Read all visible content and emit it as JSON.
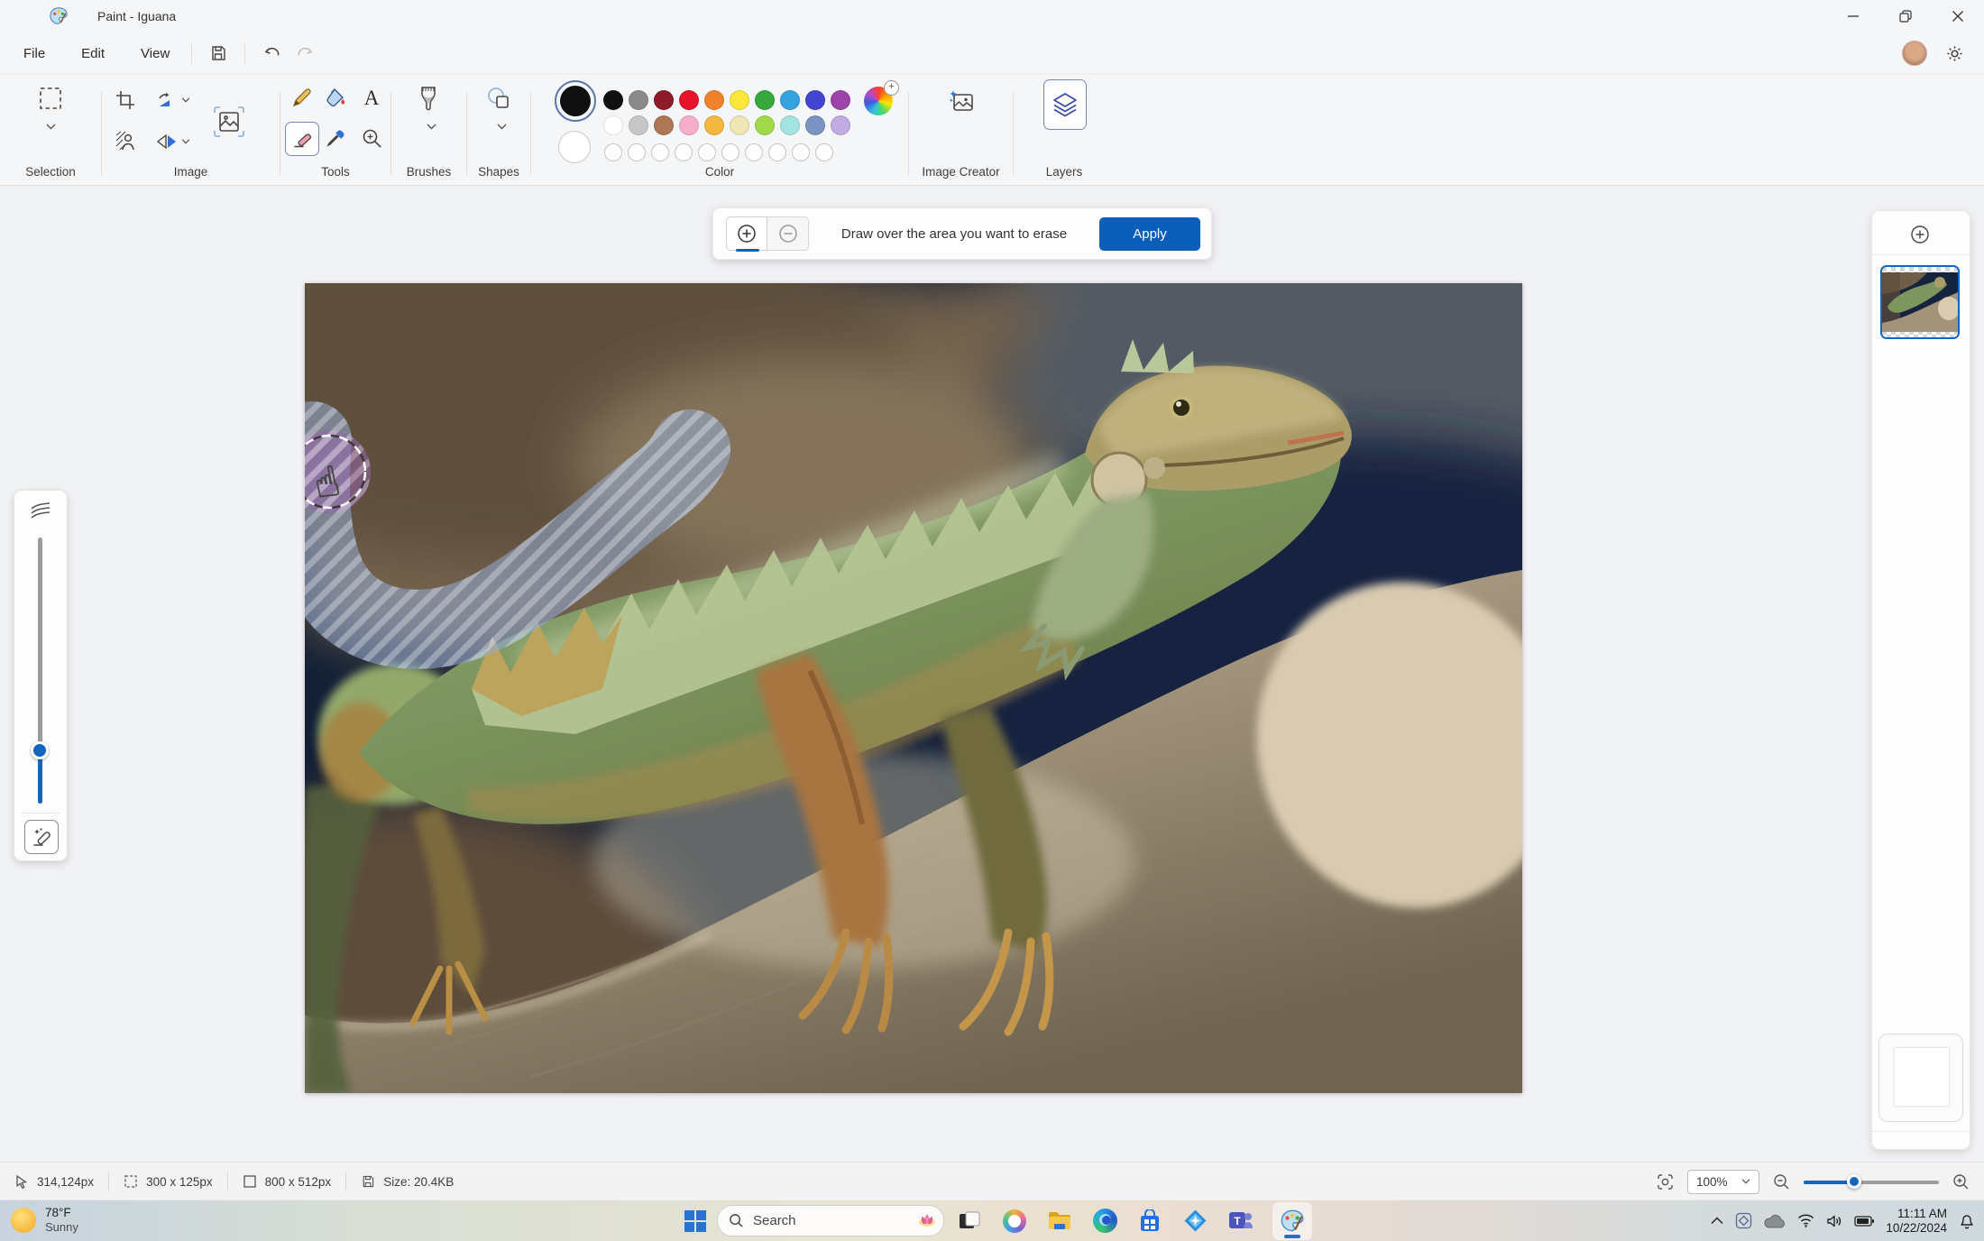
{
  "titlebar": {
    "title": "Paint - Iguana"
  },
  "menubar": {
    "items": [
      "File",
      "Edit",
      "View"
    ]
  },
  "ribbon": {
    "selection_label": "Selection",
    "image_label": "Image",
    "tools_label": "Tools",
    "brushes_label": "Brushes",
    "shapes_label": "Shapes",
    "color_label": "Color",
    "image_creator_label": "Image Creator",
    "layers_label": "Layers",
    "text_tool_glyph": "A",
    "primary_color": "#101010",
    "secondary_color": "#ffffff",
    "palette_row1": [
      "#101010",
      "#8a8a8a",
      "#8e1b2a",
      "#e7132c",
      "#f1822c",
      "#fbe83a",
      "#37a93c",
      "#35a3dd",
      "#4345d2",
      "#9c44a8"
    ],
    "palette_row2": [
      "#ffffff",
      "#c7c7c7",
      "#ad7756",
      "#f6aecb",
      "#f4b73f",
      "#efe6b5",
      "#a2d94a",
      "#a4e3e0",
      "#7b93c3",
      "#c0abe2"
    ],
    "empty_slots": 10
  },
  "notification": {
    "message": "Draw over the area you want to erase",
    "apply_label": "Apply",
    "accent": "#0b5fb8"
  },
  "statusbar": {
    "cursor_position": "314,124px",
    "selection_size": "300 x 125px",
    "image_size": "800 x 512px",
    "file_size": "Size: 20.4KB",
    "zoom_level": "100%"
  },
  "taskbar": {
    "weather_temp": "78°F",
    "weather_condition": "Sunny",
    "search_label": "Search",
    "time": "11:11 AM",
    "date": "10/22/2024"
  }
}
